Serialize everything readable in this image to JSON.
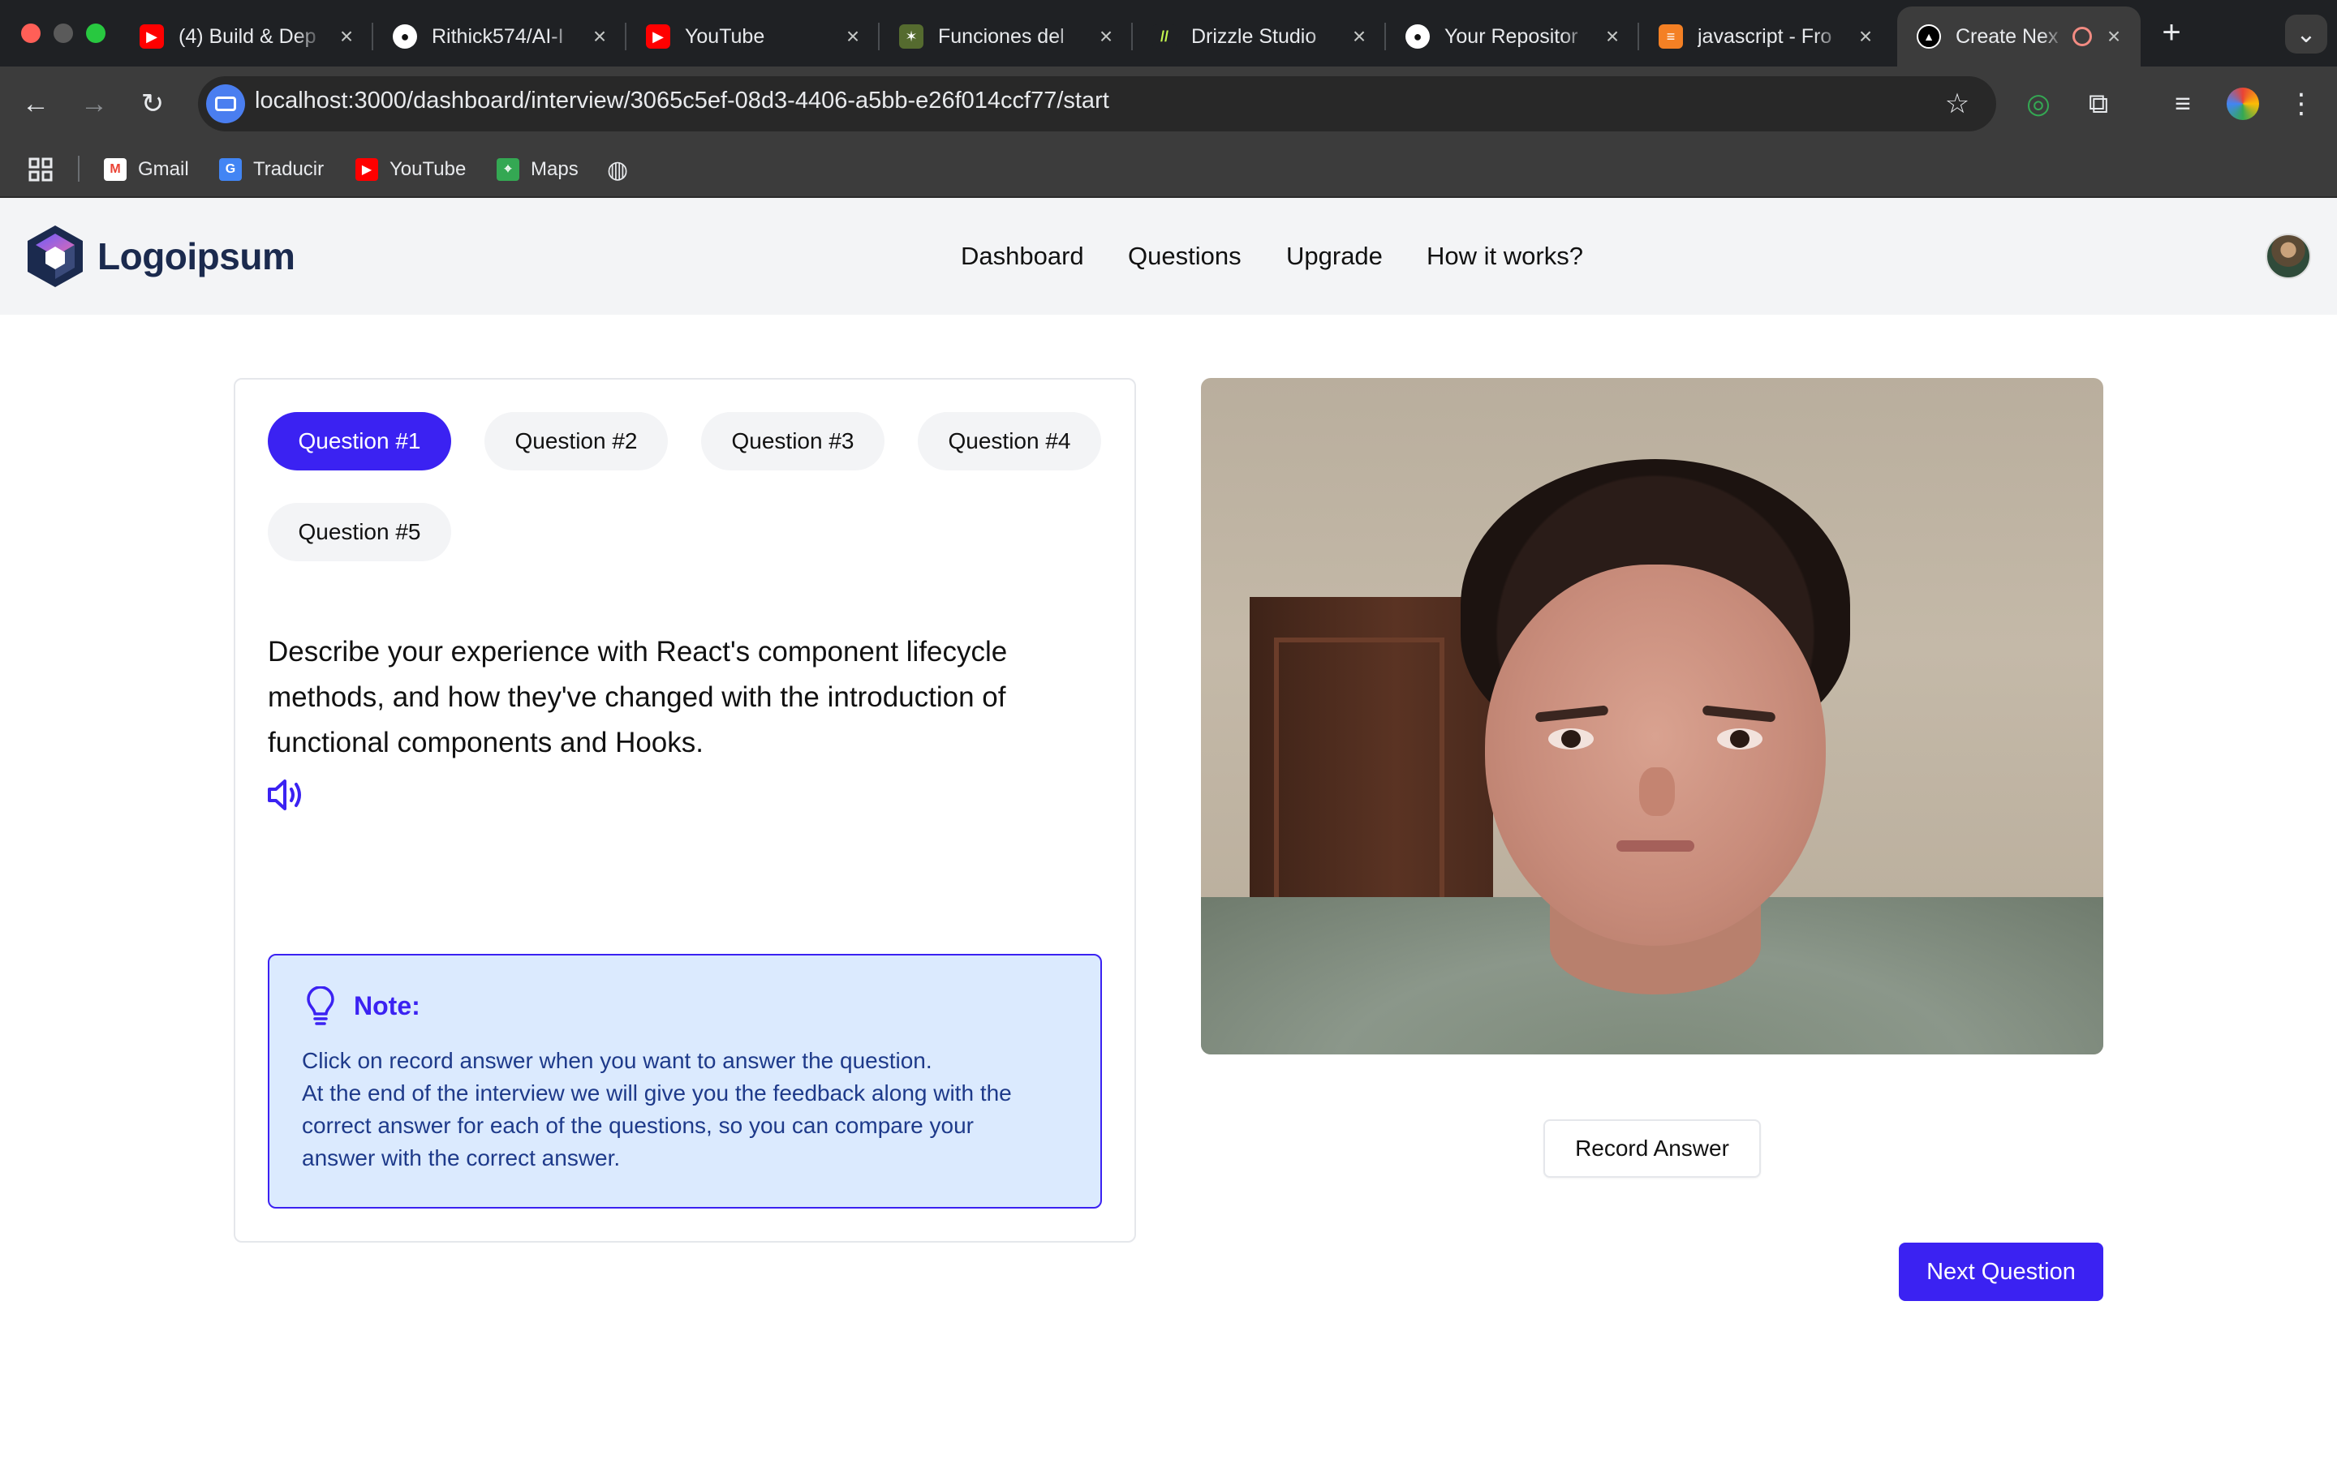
{
  "browser": {
    "tabs": [
      {
        "title": "(4) Build & Dep",
        "icon": "youtube-icon",
        "color": "#ff0000"
      },
      {
        "title": "Rithick574/AI-I",
        "icon": "github-icon",
        "color": "#ffffff"
      },
      {
        "title": "YouTube",
        "icon": "youtube-icon",
        "color": "#ff0000"
      },
      {
        "title": "Funciones del",
        "icon": "tree-icon",
        "color": "#6b8e23"
      },
      {
        "title": "Drizzle Studio",
        "icon": "drizzle-icon",
        "color": "#c5f74f"
      },
      {
        "title": "Your Repositor",
        "icon": "github-icon",
        "color": "#ffffff"
      },
      {
        "title": "javascript - Fro",
        "icon": "stackoverflow-icon",
        "color": "#f48024"
      },
      {
        "title": "Create Nex",
        "icon": "nextjs-icon",
        "color": "#ffffff",
        "active": true
      }
    ],
    "new_tab_label": "+",
    "tab_menu_label": "⌄",
    "url": "localhost:3000/dashboard/interview/3065c5ef-08d3-4406-a5bb-e26f014ccf77/start",
    "bookmarks": [
      {
        "label": "Gmail",
        "icon": "gmail-icon"
      },
      {
        "label": "Traducir",
        "icon": "translate-icon"
      },
      {
        "label": "YouTube",
        "icon": "youtube-icon"
      },
      {
        "label": "Maps",
        "icon": "maps-icon"
      }
    ]
  },
  "header": {
    "logo_text": "Logoipsum",
    "nav": [
      "Dashboard",
      "Questions",
      "Upgrade",
      "How it works?"
    ]
  },
  "questions": {
    "tabs": [
      "Question #1",
      "Question #2",
      "Question #3",
      "Question #4",
      "Question #5"
    ],
    "active_index": 0,
    "text_lines": [
      "Describe your experience with React's component lifecycle",
      "methods, and how they've changed with the introduction of",
      "functional components and Hooks."
    ]
  },
  "note": {
    "title": "Note:",
    "lines": [
      "Click on record answer when you want to answer the question.",
      "At the end of the interview we will give you the feedback along with the",
      "correct answer for each of the questions, so you can compare your",
      "answer with the correct answer."
    ]
  },
  "actions": {
    "record_label": "Record Answer",
    "next_label": "Next Question"
  },
  "colors": {
    "accent": "#3b22f2",
    "note_bg": "#dbeafe",
    "note_text": "#1e3a8a"
  }
}
